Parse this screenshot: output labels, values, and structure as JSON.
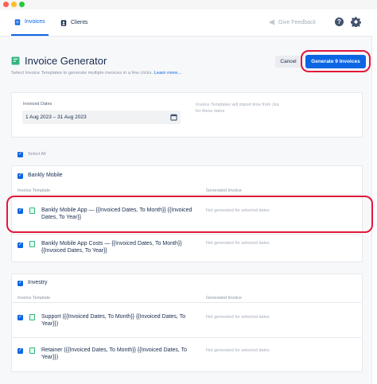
{
  "nav": {
    "tabs": [
      {
        "label": "Invoices",
        "icon": "invoice-icon"
      },
      {
        "label": "Clients",
        "icon": "clients-icon"
      }
    ],
    "feedback_label": "Give Feedback",
    "help_label": "?"
  },
  "header": {
    "title": "Invoice Generator",
    "subtitle": "Select Invoice Templates to generate multiple invoices in a few clicks.",
    "learn_more": "Learn more...",
    "cancel_label": "Cancel",
    "generate_label": "Generate 9 Invoices"
  },
  "dates": {
    "label": "Invoiced Dates",
    "value": "1 Aug 2023 – 31 Aug 2023",
    "note": "Invoice Templates will import time from Jira for these dates"
  },
  "select_all": "Select All",
  "columns": {
    "template": "Invoice Template",
    "generated": "Generated Invoice"
  },
  "groups": [
    {
      "name": "Bankly Mobile",
      "rows": [
        {
          "template": "Bankly Mobile App — {{Invoiced Dates, To Month}} {{Invoiced Dates, To Year}}",
          "status": "Not generated for selected dates"
        },
        {
          "template": "Bankly Mobile App Costs — {{Invoiced Dates, To Month}} {{Invoiced Dates, To Year}}",
          "status": "Not generated for selected dates"
        }
      ]
    },
    {
      "name": "Investry",
      "rows": [
        {
          "template": "Support ({{Invoiced Dates, To Month}} {{Invoiced Dates, To Year}})",
          "status": "Not generated for selected dates"
        },
        {
          "template": "Retainer ({{Invoiced Dates, To Month}} {{Invoiced Dates, To Year}})",
          "status": "Not generated for selected dates"
        }
      ]
    }
  ],
  "colors": {
    "accent": "#0c66e4",
    "highlight": "#e1183b",
    "sheet_icon": "#36b37e"
  }
}
